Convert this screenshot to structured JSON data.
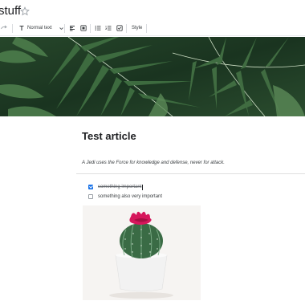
{
  "document": {
    "title": "stuff"
  },
  "toolbar": {
    "text_style": "Normal text",
    "style_button": "Style",
    "buttons": [
      "redo",
      "text-style",
      "align",
      "insert-image",
      "bulleted-list",
      "numbered-list",
      "checklist",
      "style"
    ]
  },
  "banner": {
    "icon": "palm-leaves-image"
  },
  "article": {
    "title": "Test article",
    "quote": "A Jedi uses the Force for knowledge and defense, never for attack.",
    "todos": [
      {
        "text": "something important",
        "checked": true
      },
      {
        "text": "something also very important",
        "checked": false
      }
    ],
    "image": {
      "icon": "cactus-image"
    }
  },
  "colors": {
    "accent": "#1a73e8",
    "text": "#202124",
    "leaf": "#2f5a34",
    "pot": "#f2f2f2",
    "flower": "#d6175c"
  }
}
